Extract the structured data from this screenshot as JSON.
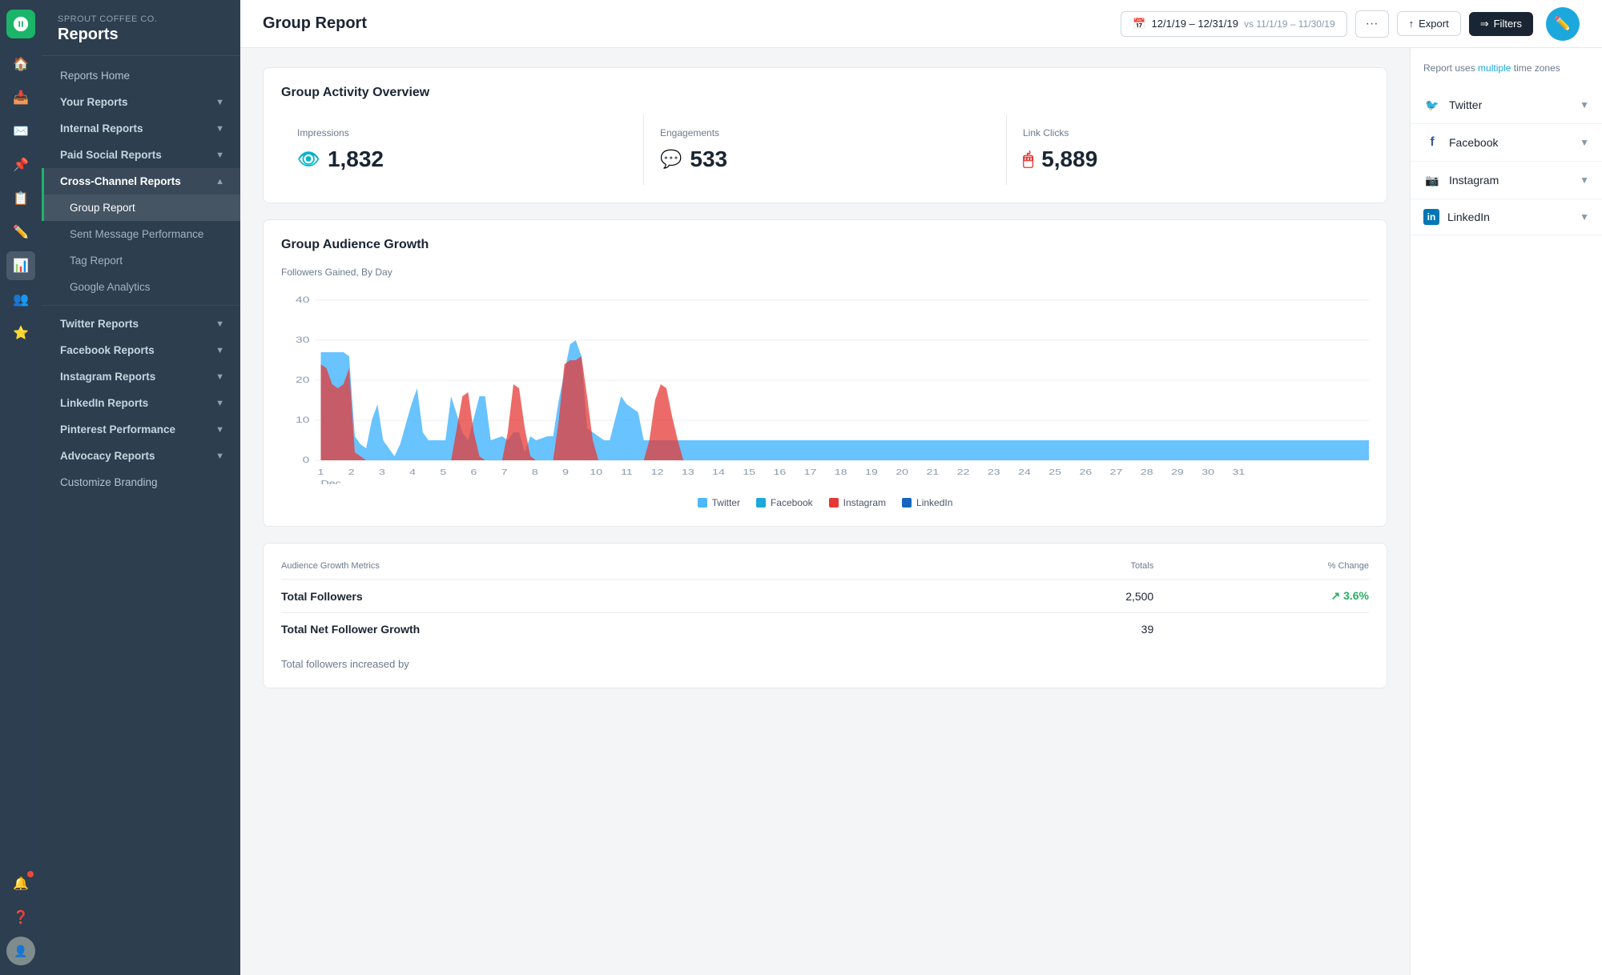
{
  "app": {
    "company": "Sprout Coffee Co.",
    "section": "Reports"
  },
  "page": {
    "title": "Group Report",
    "dateRange": "12/1/19 – 12/31/19",
    "vsDateRange": "vs 11/1/19 – 11/30/19"
  },
  "toolbar": {
    "more_label": "···",
    "export_label": "Export",
    "filters_label": "Filters"
  },
  "sidebar": {
    "reportsHome": "Reports Home",
    "yourReports": "Your Reports",
    "internalReports": "Internal Reports",
    "paidSocialReports": "Paid Social Reports",
    "crossChannelReports": "Cross-Channel Reports",
    "groupReport": "Group Report",
    "sentMessagePerformance": "Sent Message Performance",
    "tagReport": "Tag Report",
    "googleAnalytics": "Google Analytics",
    "twitterReports": "Twitter Reports",
    "facebookReports": "Facebook Reports",
    "instagramReports": "Instagram Reports",
    "linkedinReports": "LinkedIn Reports",
    "pinterestPerformance": "Pinterest Performance",
    "advocacyReports": "Advocacy Reports",
    "customizeBranding": "Customize Branding"
  },
  "overview": {
    "title": "Group Activity Overview",
    "stats": [
      {
        "label": "Impressions",
        "value": "1,832",
        "icon": "👁",
        "iconClass": "teal"
      },
      {
        "label": "Engagements",
        "value": "533",
        "icon": "💬",
        "iconClass": "purple"
      },
      {
        "label": "Link Clicks",
        "value": "5,889",
        "icon": "🖱",
        "iconClass": "red"
      }
    ]
  },
  "audienceGrowth": {
    "title": "Group Audience Growth",
    "subtitle": "Followers Gained, By Day",
    "yAxis": [
      "40",
      "30",
      "20",
      "10",
      "0"
    ],
    "xAxis": [
      "1",
      "2",
      "3",
      "4",
      "5",
      "6",
      "7",
      "8",
      "9",
      "10",
      "11",
      "12",
      "13",
      "14",
      "15",
      "16",
      "17",
      "18",
      "19",
      "20",
      "21",
      "22",
      "23",
      "24",
      "25",
      "26",
      "27",
      "28",
      "29",
      "30",
      "31"
    ],
    "xAxisLabel": "Dec",
    "legend": [
      {
        "label": "Twitter",
        "color": "#4db8ff"
      },
      {
        "label": "Facebook",
        "color": "#1ca8dd"
      },
      {
        "label": "Instagram",
        "color": "#e53935"
      },
      {
        "label": "LinkedIn",
        "color": "#1565c0"
      }
    ]
  },
  "metrics": {
    "title": "Audience Growth Metrics",
    "columns": [
      "Totals",
      "% Change"
    ],
    "rows": [
      {
        "label": "Total Followers",
        "total": "2,500",
        "change": "↗ 3.6%",
        "changeClass": "change-up"
      },
      {
        "label": "Total Net Follower Growth",
        "total": "39",
        "change": ""
      }
    ],
    "note": "Total followers increased by"
  },
  "rightPanel": {
    "timezoneNote": "Report uses",
    "timezoneLink": "multiple",
    "timezoneEnd": "time zones",
    "platforms": [
      {
        "name": "Twitter",
        "icon": "🐦",
        "iconBg": "#1da1f2"
      },
      {
        "name": "Facebook",
        "icon": "f",
        "iconBg": "#3b5998"
      },
      {
        "name": "Instagram",
        "icon": "📷",
        "iconBg": "#c13584"
      },
      {
        "name": "LinkedIn",
        "icon": "in",
        "iconBg": "#0077b5"
      }
    ]
  }
}
